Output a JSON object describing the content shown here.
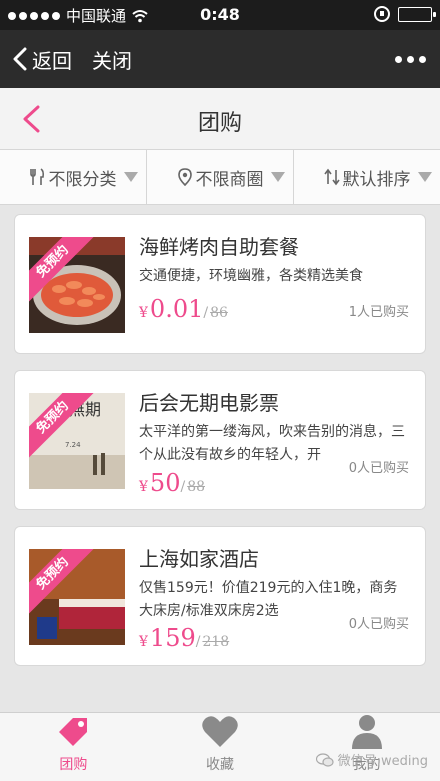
{
  "status_bar": {
    "carrier": "中国联通",
    "time": "0:48"
  },
  "wechat_nav": {
    "back_label": "返回",
    "close_label": "关闭"
  },
  "header": {
    "title": "团购"
  },
  "filters": [
    {
      "label": "不限分类",
      "icon": "fork-knife-icon"
    },
    {
      "label": "不限商圈",
      "icon": "location-pin-icon"
    },
    {
      "label": "默认排序",
      "icon": "sort-arrows-icon"
    }
  ],
  "deals": [
    {
      "title": "海鲜烤肉自助套餐",
      "description": "交通便捷，环境幽雅，各类精选美食",
      "currency": "¥",
      "price": "0.01",
      "original_price": "86",
      "sold": "1人已购买",
      "badge": "免预约"
    },
    {
      "title": "后会无期电影票",
      "description": "太平洋的第一缕海风，吹来告别的消息，三个从此没有故乡的年轻人，开",
      "currency": "¥",
      "price": "50",
      "original_price": "88",
      "sold": "0人已购买",
      "badge": "免预约"
    },
    {
      "title": "上海如家酒店",
      "description": "仅售159元！价值219元的入住1晚，商务大床房/标准双床房2选",
      "currency": "¥",
      "price": "159",
      "original_price": "218",
      "sold": "0人已购买",
      "badge": "免预约"
    }
  ],
  "tabs": [
    {
      "label": "团购",
      "icon": "tag-icon",
      "active": true
    },
    {
      "label": "收藏",
      "icon": "heart-icon",
      "active": false
    },
    {
      "label": "我的",
      "icon": "person-icon",
      "active": false
    }
  ],
  "watermark": "微信号:weding",
  "colors": {
    "accent": "#ee4b8c",
    "nav_bg": "#2c2c2c"
  }
}
